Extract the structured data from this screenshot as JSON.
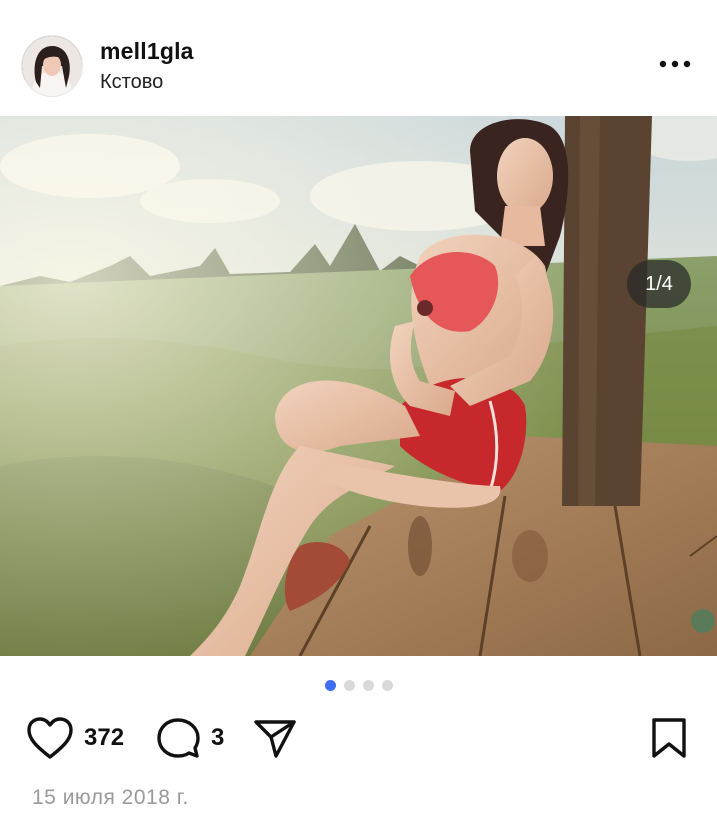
{
  "post": {
    "username": "mell1gla",
    "location": "Кстово",
    "media_counter": "1/4",
    "likes": "372",
    "comments": "3",
    "date": "15 июля 2018 г.",
    "carousel": {
      "total": 4,
      "active": 1
    }
  },
  "icons": {
    "more": "more-horizontal-icon",
    "like": "heart-icon",
    "comment": "comment-icon",
    "share": "send-icon",
    "save": "bookmark-icon"
  },
  "colors": {
    "dot_active": "#3f6ff0",
    "dot_inactive": "#d9d9d9",
    "date_text": "#9a9a9a"
  }
}
